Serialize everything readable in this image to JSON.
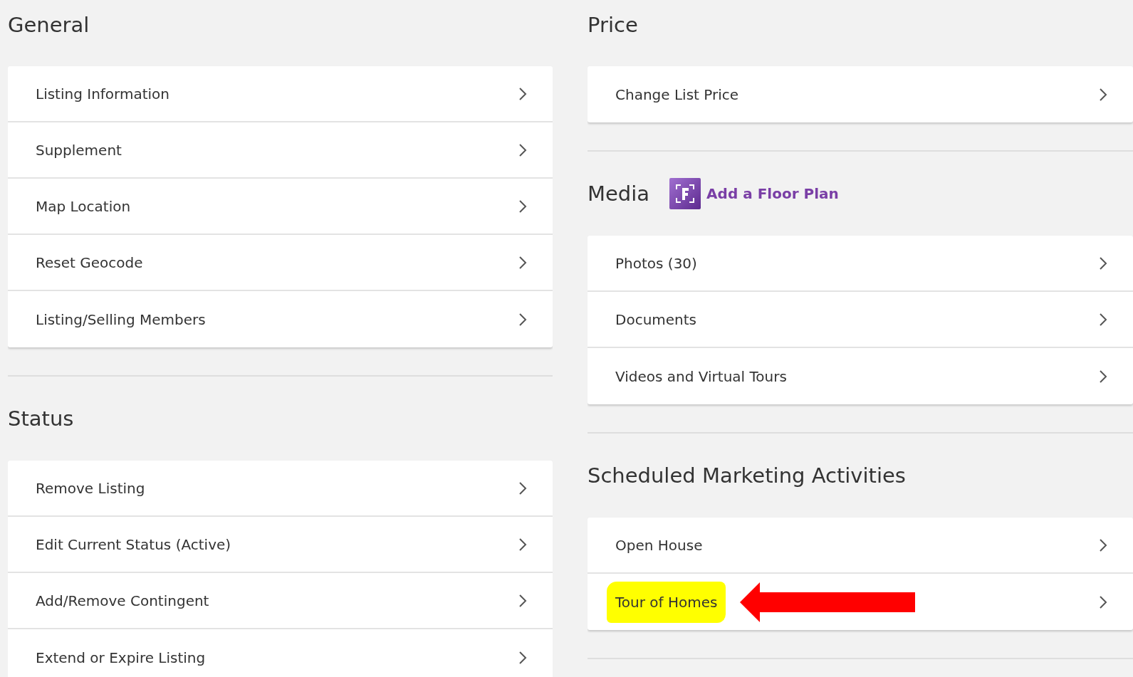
{
  "columns": [
    {
      "sections": [
        {
          "title": "General",
          "items": [
            {
              "label": "Listing Information",
              "highlighted": false,
              "arrow": false
            },
            {
              "label": "Supplement",
              "highlighted": false,
              "arrow": false
            },
            {
              "label": "Map Location",
              "highlighted": false,
              "arrow": false
            },
            {
              "label": "Reset Geocode",
              "highlighted": false,
              "arrow": false
            },
            {
              "label": "Listing/Selling Members",
              "highlighted": false,
              "arrow": false
            }
          ]
        },
        {
          "title": "Status",
          "items": [
            {
              "label": "Remove Listing",
              "highlighted": false,
              "arrow": false
            },
            {
              "label": "Edit Current Status (Active)",
              "highlighted": false,
              "arrow": false
            },
            {
              "label": "Add/Remove Contingent",
              "highlighted": false,
              "arrow": false
            },
            {
              "label": "Extend or Expire Listing",
              "highlighted": false,
              "arrow": false
            }
          ]
        }
      ]
    },
    {
      "sections": [
        {
          "title": "Price",
          "items": [
            {
              "label": "Change List Price",
              "highlighted": false,
              "arrow": false
            }
          ]
        },
        {
          "title": "Media",
          "link": "Add a Floor Plan",
          "items": [
            {
              "label": "Photos (30)",
              "highlighted": false,
              "arrow": false
            },
            {
              "label": "Documents",
              "highlighted": false,
              "arrow": false
            },
            {
              "label": "Videos and Virtual Tours",
              "highlighted": false,
              "arrow": false
            }
          ]
        },
        {
          "title": "Scheduled Marketing Activities",
          "items": [
            {
              "label": "Open House",
              "highlighted": false,
              "arrow": false
            },
            {
              "label": "Tour of Homes",
              "highlighted": true,
              "arrow": true
            }
          ]
        }
      ]
    }
  ]
}
